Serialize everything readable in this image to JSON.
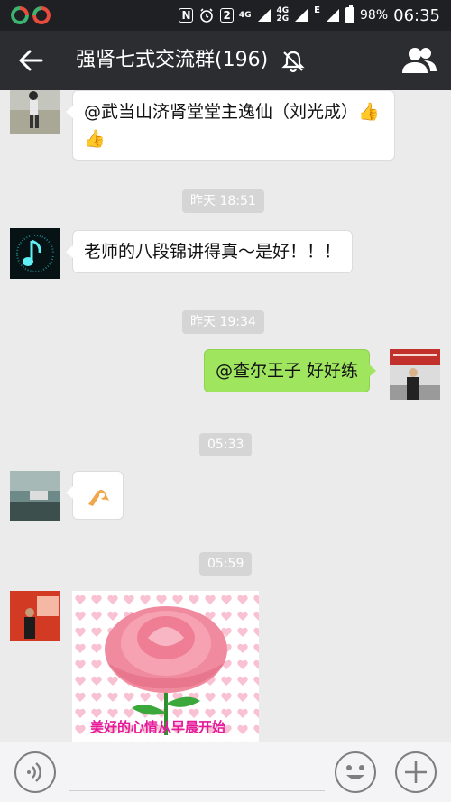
{
  "status_bar": {
    "nfc": "N",
    "sim_badge": "2",
    "net_a_top": "4G",
    "net_a_bottom": "",
    "net_b_top": "4G",
    "net_b_bottom": "2G",
    "data_type": "E",
    "battery": "98%",
    "time": "06:35"
  },
  "header": {
    "title": "强肾七式交流群(196)",
    "icons": [
      "back-arrow-icon",
      "mute-bell-icon",
      "group-members-icon"
    ]
  },
  "messages": [
    {
      "type": "text",
      "side": "left",
      "text": "@武当山济肾堂堂主逸仙（刘光成）👍👍"
    },
    {
      "type": "timestamp",
      "text": "昨天 18:51"
    },
    {
      "type": "text",
      "side": "left",
      "text": "老师的八段锦讲得真～是好！！！"
    },
    {
      "type": "timestamp",
      "text": "昨天 19:34"
    },
    {
      "type": "text",
      "side": "right",
      "text": "@查尔王子 好好练"
    },
    {
      "type": "timestamp",
      "text": "05:33"
    },
    {
      "type": "emoji",
      "side": "left",
      "icon": "ok-hand-icon"
    },
    {
      "type": "timestamp",
      "text": "05:59"
    },
    {
      "type": "image",
      "side": "left",
      "caption": "美好的心情从早晨开始"
    }
  ],
  "input_bar": {
    "placeholder": "",
    "icons": [
      "voice-icon",
      "emoji-icon",
      "plus-icon"
    ]
  },
  "colors": {
    "status_bar": "#1f2023",
    "title_bar": "#2c2d31",
    "chat_bg": "#ebebeb",
    "sent_bubble": "#9fe55e",
    "timestamp_bg": "#d5d5d5",
    "caption": "#e6199a"
  }
}
